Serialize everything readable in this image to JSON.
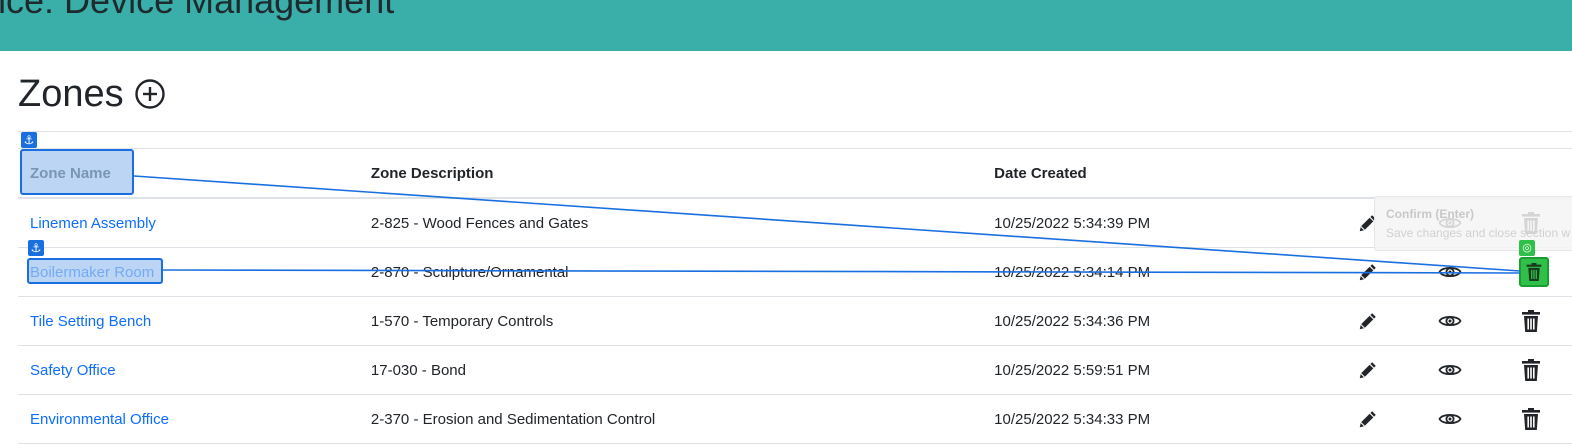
{
  "header": {
    "title": "nce: Device Management"
  },
  "page": {
    "heading": "Zones"
  },
  "table": {
    "columns": [
      "Zone Name",
      "Zone Description",
      "Date Created"
    ],
    "rows": [
      {
        "name": "Linemen Assembly",
        "description": "2-825 - Wood Fences and Gates",
        "date": "10/25/2022 5:34:39 PM"
      },
      {
        "name": "Boilermaker Room",
        "description": "2-870 - Sculpture/Ornamental",
        "date": "10/25/2022 5:34:14 PM"
      },
      {
        "name": "Tile Setting Bench",
        "description": "1-570 - Temporary Controls",
        "date": "10/25/2022 5:34:36 PM"
      },
      {
        "name": "Safety Office",
        "description": "17-030 - Bond",
        "date": "10/25/2022 5:59:51 PM"
      },
      {
        "name": "Environmental Office",
        "description": "2-370 - Erosion and Sedimentation Control",
        "date": "10/25/2022 5:34:33 PM"
      }
    ]
  },
  "tooltip": {
    "title": "Confirm (Enter)",
    "description": "Save changes and close section w"
  },
  "colors": {
    "header_bg": "#3aafa9",
    "link": "#0d6efd",
    "annotation_blue": "#1a6fe0",
    "annotation_green": "#2fc04a"
  },
  "icons": {
    "add": "plus-circle-icon",
    "edit": "pencil-icon",
    "view": "eye-icon",
    "delete": "trash-icon",
    "anchor": "anchor-icon",
    "target": "target-icon"
  }
}
